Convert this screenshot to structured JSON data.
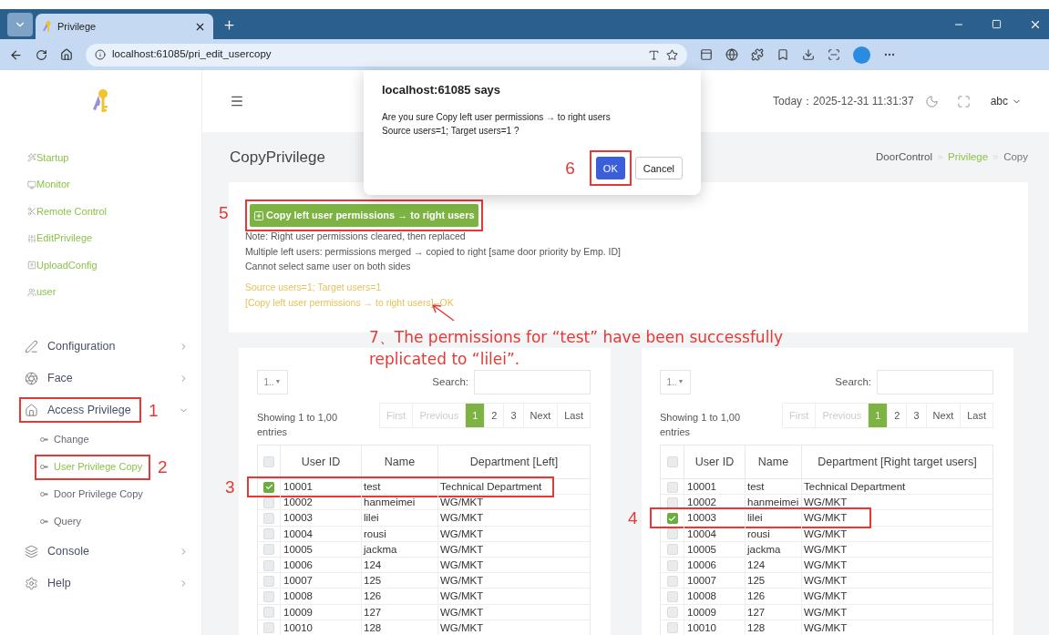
{
  "browser": {
    "tab_title": "Privilege",
    "url": "localhost:61085/pri_edit_usercopy"
  },
  "sidebar": {
    "links": [
      "Startup",
      "Monitor",
      "Remote Control",
      "EditPrivilege",
      "UploadConfig",
      "user"
    ],
    "menu": [
      {
        "label": "Configuration",
        "expanded": false
      },
      {
        "label": "Face",
        "expanded": false
      },
      {
        "label": "Access Privilege",
        "expanded": true,
        "marker": "1",
        "children": [
          {
            "label": "Change",
            "selected": false
          },
          {
            "label": "User Privilege Copy",
            "selected": true,
            "marker": "2"
          },
          {
            "label": "Door Privilege Copy",
            "selected": false
          },
          {
            "label": "Query",
            "selected": false
          }
        ]
      },
      {
        "label": "Console",
        "expanded": false
      },
      {
        "label": "Help",
        "expanded": false
      }
    ]
  },
  "header": {
    "date": "Today：2025-12-31 11:31:37",
    "user": "abc"
  },
  "page_title": "CopyPrivilege",
  "breadcrumb": [
    {
      "label": "DoorControl",
      "selected": false
    },
    {
      "label": "Privilege",
      "selected": false
    },
    {
      "label": "Copy",
      "selected": true
    }
  ],
  "copy_button": {
    "label": "Copy left user permissions → to right users",
    "marker": "5"
  },
  "notes": [
    "Note: Right user permissions cleared, then replaced",
    "Multiple left users: permissions merged → copied to right [same door priority by Emp. ID]",
    "Cannot select same user on both sides"
  ],
  "status": [
    "Source users=1; Target users=1",
    "[Copy left user permissions → to right users]--OK"
  ],
  "annotation_note": "7、The permissions for “test” have been successfully replicated to “lilei”.",
  "tables": [
    {
      "length": "1..",
      "length_caret": "▼",
      "all_checked": false,
      "search_label": "Search:",
      "info": "Showing 1 to 1,00",
      "info_line2": "entries",
      "pagination": [
        {
          "label": "First",
          "disabled": true,
          "selected": false
        },
        {
          "label": "Previous",
          "disabled": true,
          "selected": false
        },
        {
          "label": "1",
          "disabled": false,
          "selected": true
        },
        {
          "label": "2",
          "disabled": false,
          "selected": false
        },
        {
          "label": "3",
          "disabled": false,
          "selected": false
        },
        {
          "label": "Next",
          "disabled": false,
          "selected": false
        },
        {
          "label": "Last",
          "disabled": false,
          "selected": false
        }
      ],
      "columns": [
        "User ID",
        "Name",
        "Department [Left]"
      ],
      "rows": [
        {
          "id": "10001",
          "name": "test",
          "dept": "Technical Department",
          "checked": true,
          "marker": "3"
        },
        {
          "id": "10002",
          "name": "hanmeimei",
          "dept": "WG/MKT",
          "checked": false
        },
        {
          "id": "10003",
          "name": "lilei",
          "dept": "WG/MKT",
          "checked": false
        },
        {
          "id": "10004",
          "name": "rousi",
          "dept": "WG/MKT",
          "checked": false
        },
        {
          "id": "10005",
          "name": "jackma",
          "dept": "WG/MKT",
          "checked": false
        },
        {
          "id": "10006",
          "name": "124",
          "dept": "WG/MKT",
          "checked": false
        },
        {
          "id": "10007",
          "name": "125",
          "dept": "WG/MKT",
          "checked": false
        },
        {
          "id": "10008",
          "name": "126",
          "dept": "WG/MKT",
          "checked": false
        },
        {
          "id": "10009",
          "name": "127",
          "dept": "WG/MKT",
          "checked": false
        },
        {
          "id": "10010",
          "name": "128",
          "dept": "WG/MKT",
          "checked": false
        }
      ]
    },
    {
      "length": "1..",
      "length_caret": "▼",
      "all_checked": false,
      "search_label": "Search:",
      "info": "Showing 1 to 1,00",
      "info_line2": "entries",
      "pagination": [
        {
          "label": "First",
          "disabled": true,
          "selected": false
        },
        {
          "label": "Previous",
          "disabled": true,
          "selected": false
        },
        {
          "label": "1",
          "disabled": false,
          "selected": true
        },
        {
          "label": "2",
          "disabled": false,
          "selected": false
        },
        {
          "label": "3",
          "disabled": false,
          "selected": false
        },
        {
          "label": "Next",
          "disabled": false,
          "selected": false
        },
        {
          "label": "Last",
          "disabled": false,
          "selected": false
        }
      ],
      "columns": [
        "User ID",
        "Name",
        "Department [Right target users]"
      ],
      "rows": [
        {
          "id": "10001",
          "name": "test",
          "dept": "Technical Department",
          "checked": false
        },
        {
          "id": "10002",
          "name": "hanmeimei",
          "dept": "WG/MKT",
          "checked": false
        },
        {
          "id": "10003",
          "name": "lilei",
          "dept": "WG/MKT",
          "checked": true,
          "marker": "4"
        },
        {
          "id": "10004",
          "name": "rousi",
          "dept": "WG/MKT",
          "checked": false
        },
        {
          "id": "10005",
          "name": "jackma",
          "dept": "WG/MKT",
          "checked": false
        },
        {
          "id": "10006",
          "name": "124",
          "dept": "WG/MKT",
          "checked": false
        },
        {
          "id": "10007",
          "name": "125",
          "dept": "WG/MKT",
          "checked": false
        },
        {
          "id": "10008",
          "name": "126",
          "dept": "WG/MKT",
          "checked": false
        },
        {
          "id": "10009",
          "name": "127",
          "dept": "WG/MKT",
          "checked": false
        },
        {
          "id": "10010",
          "name": "128",
          "dept": "WG/MKT",
          "checked": false
        }
      ]
    }
  ],
  "dialog": {
    "title": "localhost:61085 says",
    "message": [
      "Are you sure Copy left user permissions → to right users",
      "Source users=1; Target users=1 ?"
    ],
    "buttons": [
      {
        "label": "OK",
        "kind": "primary",
        "marker": "6"
      },
      {
        "label": "Cancel",
        "kind": "secondary"
      }
    ]
  }
}
